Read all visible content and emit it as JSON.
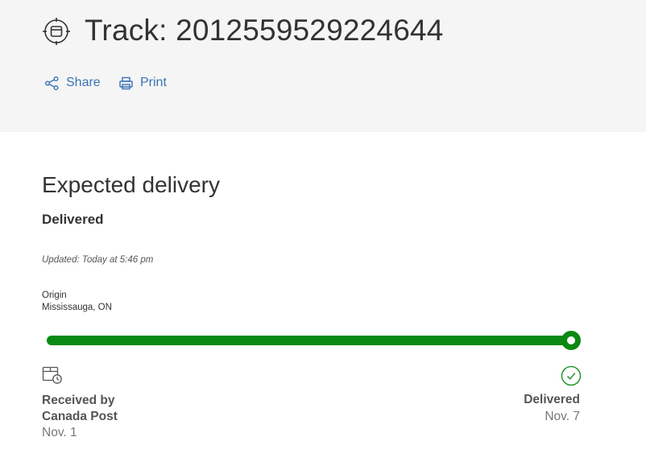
{
  "header": {
    "title": "Track: 2012559529224644",
    "actions": {
      "share_label": "Share",
      "print_label": "Print"
    }
  },
  "delivery": {
    "section_title": "Expected delivery",
    "status": "Delivered",
    "updated": "Updated: Today at 5:46 pm",
    "origin_label": "Origin",
    "origin_city": "Mississauga, ON",
    "progress_percent": 100
  },
  "milestones": {
    "start": {
      "label": "Received by Canada Post",
      "date": "Nov. 1",
      "icon": "package-clock-icon"
    },
    "end": {
      "label": "Delivered",
      "date": "Nov. 7",
      "icon": "check-circle-icon"
    }
  },
  "colors": {
    "accent": "#3a73b5",
    "progress": "#0a8a12",
    "header_bg": "#f5f5f5"
  }
}
